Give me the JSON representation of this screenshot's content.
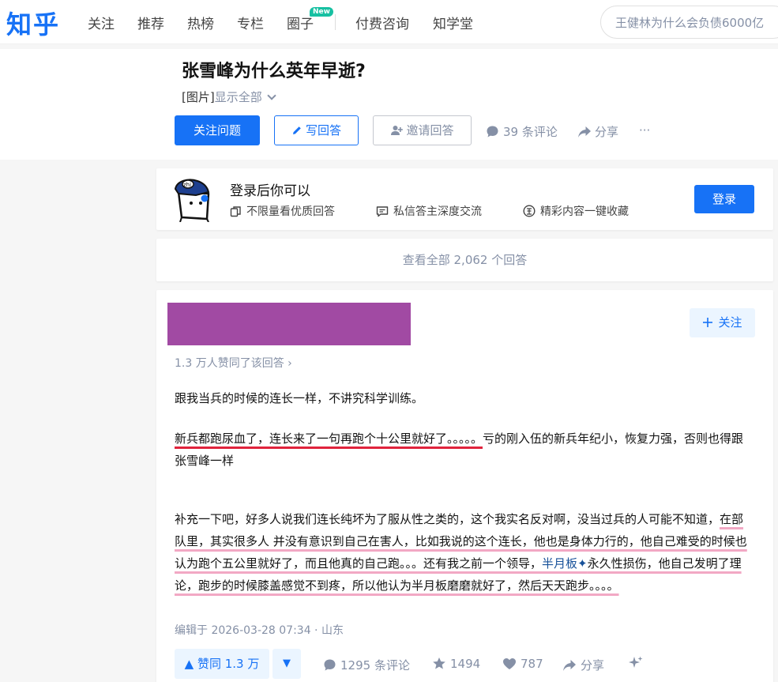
{
  "nav": {
    "logo": "知乎",
    "items": [
      "关注",
      "推荐",
      "热榜",
      "专栏",
      "圈子",
      "付费咨询",
      "知学堂"
    ],
    "badge": "New",
    "search_value": "王健林为什么会负债6000亿"
  },
  "question": {
    "title": "张雪峰为什么英年早逝?",
    "desc_tag": "[图片]",
    "desc_more": "显示全部",
    "follow_label": "关注问题",
    "write_label": "写回答",
    "invite_label": "邀请回答",
    "comments_label": "39 条评论",
    "share_label": "分享",
    "more_label": "···"
  },
  "login": {
    "title": "登录后你可以",
    "perks": [
      "不限量看优质回答",
      "私信答主深度交流",
      "精彩内容一键收藏"
    ],
    "button": "登录"
  },
  "all_answers_label": "查看全部 2,062 个回答",
  "answer": {
    "follow_label": "关注",
    "vote_summary": "1.3 万人赞同了该回答 ›",
    "p1": "跟我当兵的时候的连长一样，不讲究科学训练。",
    "p2_underlined": "新兵都跑尿血了，连长来了一句再跑个十公里就好了。。。。。",
    "p2_rest": "亏的刚入伍的新兵年纪小，恢复力强，否则也得跟张雪峰一样",
    "p3_a": "补充一下吧，好多人说我们连长纯坏为了服从性之类的，这个我实名反对啊，没当过兵的人可能不知道，",
    "p3_b": "在部队里，其实很多人 并没有意识到自己在害人，比如我说的这个连长，他也是身体力行的，他自己难受的时候也认为跑个五公里就好了，而且他真的自己跑。。。还有我之前一个领导，",
    "p3_link": "半月板✦",
    "p3_c": "永久性损伤，他自己发明了理论，跑步的时候膝盖感觉不到疼，所以他认为半月板磨磨就好了，然后天天跑步。。。。",
    "edited": "编辑于 2026-03-28 07:34 · 山东",
    "upvote_label": "▲ 赞同 1.3 万",
    "downvote_label": "▼",
    "comments_label": "1295 条评论",
    "favorites_label": "1494",
    "likes_label": "787",
    "share_label": "分享"
  },
  "colors": {
    "brand": "#1772f6",
    "muted": "#8590a6",
    "underline_red": "#e0233c",
    "underline_pink": "#f2a8c4",
    "author_block": "#a14aa3"
  }
}
